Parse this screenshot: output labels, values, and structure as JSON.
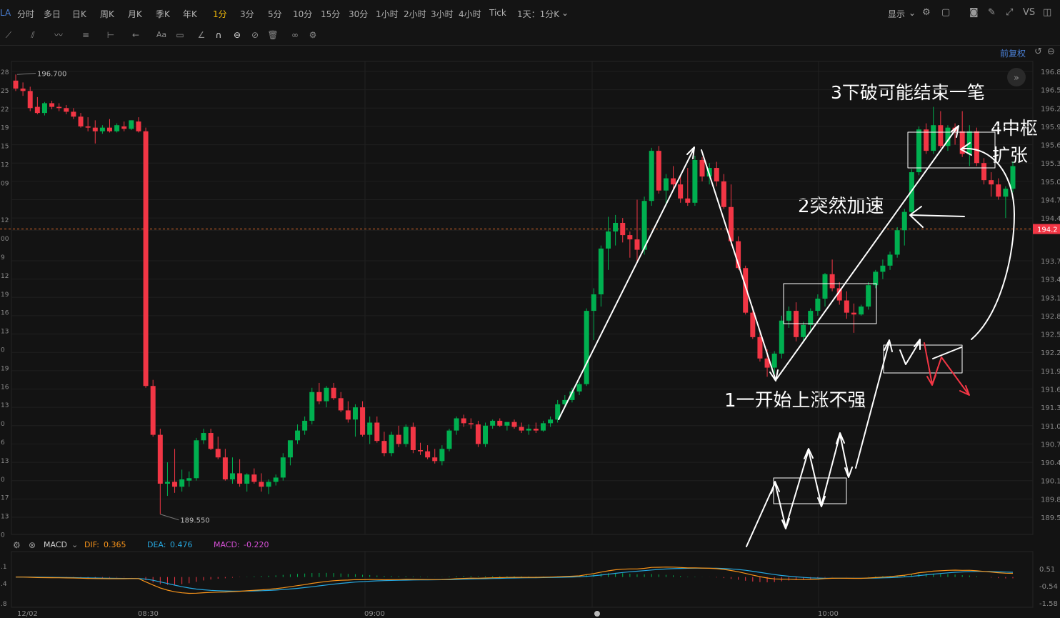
{
  "toolbar": {
    "symbol_short": "LA",
    "tabs": [
      "分时",
      "多日",
      "日K",
      "周K",
      "月K",
      "季K",
      "年K",
      "1分",
      "3分",
      "5分",
      "10分",
      "15分",
      "30分",
      "1小时",
      "2小时",
      "3小时",
      "4小时",
      "Tick"
    ],
    "active_tab": "1分",
    "range_selector": "1天：1分K",
    "display_label": "显示",
    "vs_label": "VS",
    "fuquan_label": "前复权"
  },
  "colors": {
    "up": "#00b050",
    "down": "#f23645",
    "background": "#131313",
    "dif": "#f7931a",
    "dea": "#26a8e0",
    "macd": "#d44fd4",
    "ref_line": "#e06a2a"
  },
  "chart_data": {
    "type": "candlestick",
    "timeframe": "1分",
    "price_axis_ticks": [
      "196.8",
      "196.5",
      "196.2",
      "195.9",
      "195.6",
      "195.3",
      "195.0",
      "194.7",
      "194.4",
      "194.2",
      "193.7",
      "193.4",
      "193.1",
      "192.8",
      "192.5",
      "192.2",
      "191.9",
      "191.6",
      "191.3",
      "191.0",
      "190.7",
      "190.4",
      "190.1",
      "189.8",
      "189.5"
    ],
    "price_axis_ticks_left": [
      "28",
      "25",
      "22",
      "19",
      "15",
      "12",
      "09",
      "",
      "12",
      "00",
      "9",
      "12",
      "19",
      "16",
      "13",
      "0",
      "19",
      "16",
      "13",
      "0",
      "6",
      "13",
      "0",
      "17",
      "13",
      "0"
    ],
    "ylim": [
      189.3,
      196.9
    ],
    "time_labels": [
      "12/02",
      "08:30",
      "09:00",
      "10:00"
    ],
    "current_price_label": "194.2",
    "current_price": 194.22,
    "high_label": "196.700",
    "low_label": "189.550",
    "ohlc": [
      [
        196.65,
        196.75,
        196.48,
        196.52
      ],
      [
        196.52,
        196.62,
        196.4,
        196.48
      ],
      [
        196.48,
        196.55,
        196.15,
        196.2
      ],
      [
        196.22,
        196.38,
        196.1,
        196.12
      ],
      [
        196.12,
        196.3,
        196.08,
        196.28
      ],
      [
        196.28,
        196.32,
        196.18,
        196.22
      ],
      [
        196.22,
        196.28,
        196.15,
        196.2
      ],
      [
        196.2,
        196.25,
        196.1,
        196.14
      ],
      [
        196.14,
        196.2,
        196.02,
        196.06
      ],
      [
        196.06,
        196.12,
        195.88,
        195.9
      ],
      [
        195.9,
        196.05,
        195.82,
        195.88
      ],
      [
        195.88,
        196.0,
        195.62,
        195.82
      ],
      [
        195.82,
        195.92,
        195.78,
        195.88
      ],
      [
        195.88,
        196.02,
        195.8,
        195.82
      ],
      [
        195.82,
        195.95,
        195.8,
        195.92
      ],
      [
        195.9,
        195.98,
        195.82,
        195.86
      ],
      [
        195.86,
        196.0,
        195.84,
        196.0
      ],
      [
        195.98,
        196.05,
        195.8,
        195.82
      ],
      [
        195.82,
        195.88,
        191.62,
        191.65
      ],
      [
        191.65,
        191.75,
        190.82,
        190.85
      ],
      [
        190.85,
        190.95,
        189.55,
        190.05
      ],
      [
        190.05,
        190.4,
        189.85,
        190.08
      ],
      [
        190.08,
        190.62,
        189.9,
        190.0
      ],
      [
        190.0,
        190.28,
        189.92,
        190.12
      ],
      [
        190.1,
        190.25,
        190.0,
        190.14
      ],
      [
        190.14,
        190.8,
        190.1,
        190.76
      ],
      [
        190.76,
        190.95,
        190.7,
        190.88
      ],
      [
        190.88,
        190.95,
        190.6,
        190.62
      ],
      [
        190.62,
        190.82,
        190.45,
        190.48
      ],
      [
        190.48,
        190.62,
        190.1,
        190.12
      ],
      [
        190.12,
        190.48,
        190.05,
        190.22
      ],
      [
        190.22,
        190.45,
        190.0,
        190.05
      ],
      [
        190.05,
        190.22,
        189.92,
        190.2
      ],
      [
        190.2,
        190.3,
        190.05,
        190.08
      ],
      [
        190.08,
        190.22,
        189.92,
        190.0
      ],
      [
        190.0,
        190.12,
        189.88,
        190.08
      ],
      [
        190.08,
        190.2,
        190.02,
        190.15
      ],
      [
        190.15,
        190.55,
        190.1,
        190.48
      ],
      [
        190.48,
        190.72,
        190.35,
        190.76
      ],
      [
        190.76,
        191.02,
        190.7,
        190.92
      ],
      [
        190.92,
        191.15,
        190.85,
        191.08
      ],
      [
        191.08,
        191.62,
        191.02,
        191.55
      ],
      [
        191.55,
        191.7,
        191.35,
        191.4
      ],
      [
        191.4,
        191.65,
        191.3,
        191.62
      ],
      [
        191.62,
        191.7,
        191.42,
        191.45
      ],
      [
        191.45,
        191.55,
        191.22,
        191.25
      ],
      [
        191.25,
        191.4,
        191.05,
        191.1
      ],
      [
        191.1,
        191.35,
        190.82,
        191.3
      ],
      [
        191.3,
        191.4,
        190.82,
        190.85
      ],
      [
        190.85,
        191.15,
        190.7,
        191.05
      ],
      [
        191.05,
        191.15,
        190.72,
        190.75
      ],
      [
        190.75,
        190.9,
        190.5,
        190.55
      ],
      [
        190.55,
        190.9,
        190.5,
        190.85
      ],
      [
        190.85,
        191.0,
        190.65,
        190.7
      ],
      [
        190.7,
        191.02,
        190.65,
        190.98
      ],
      [
        190.98,
        191.05,
        190.55,
        190.6
      ],
      [
        190.6,
        190.72,
        190.52,
        190.58
      ],
      [
        190.58,
        190.68,
        190.45,
        190.48
      ],
      [
        190.48,
        190.62,
        190.38,
        190.42
      ],
      [
        190.42,
        190.68,
        190.35,
        190.62
      ],
      [
        190.62,
        190.95,
        190.58,
        190.92
      ],
      [
        190.92,
        191.15,
        190.85,
        191.12
      ],
      [
        191.12,
        191.18,
        190.98,
        191.04
      ],
      [
        191.04,
        191.12,
        190.95,
        191.02
      ],
      [
        191.02,
        191.08,
        190.65,
        190.7
      ],
      [
        190.7,
        191.05,
        190.65,
        191.0
      ],
      [
        191.0,
        191.1,
        190.95,
        191.08
      ],
      [
        191.08,
        191.12,
        190.98,
        191.0
      ],
      [
        191.0,
        191.05,
        190.92,
        191.06
      ],
      [
        191.06,
        191.1,
        190.95,
        190.98
      ],
      [
        190.98,
        191.05,
        190.88,
        190.92
      ],
      [
        190.92,
        191.02,
        190.85,
        190.95
      ],
      [
        190.95,
        191.05,
        190.88,
        190.92
      ],
      [
        190.92,
        191.08,
        190.9,
        191.04
      ],
      [
        191.04,
        191.15,
        190.98,
        191.1
      ],
      [
        191.1,
        191.42,
        191.05,
        191.35
      ],
      [
        191.35,
        191.5,
        191.3,
        191.42
      ],
      [
        191.42,
        191.62,
        191.38,
        191.56
      ],
      [
        191.56,
        191.72,
        191.5,
        191.68
      ],
      [
        191.68,
        192.92,
        191.65,
        192.88
      ],
      [
        192.88,
        193.25,
        192.4,
        193.15
      ],
      [
        193.15,
        193.95,
        192.95,
        193.9
      ],
      [
        193.9,
        194.42,
        193.55,
        194.18
      ],
      [
        194.18,
        194.45,
        193.95,
        194.32
      ],
      [
        194.32,
        194.4,
        194.0,
        194.12
      ],
      [
        194.12,
        194.18,
        193.75,
        194.05
      ],
      [
        194.05,
        194.7,
        193.7,
        193.88
      ],
      [
        193.88,
        194.75,
        193.8,
        194.68
      ],
      [
        194.68,
        195.55,
        194.6,
        195.5
      ],
      [
        195.5,
        195.58,
        194.8,
        194.85
      ],
      [
        194.85,
        195.12,
        194.6,
        195.05
      ],
      [
        195.05,
        195.25,
        194.85,
        194.95
      ],
      [
        194.95,
        195.1,
        194.65,
        194.72
      ],
      [
        194.72,
        195.22,
        194.6,
        194.65
      ],
      [
        194.65,
        195.42,
        194.6,
        195.35
      ],
      [
        195.35,
        195.4,
        195.0,
        195.08
      ],
      [
        195.08,
        195.3,
        194.95,
        195.22
      ],
      [
        195.22,
        195.32,
        194.92,
        195.0
      ],
      [
        195.0,
        195.12,
        194.55,
        194.58
      ],
      [
        194.58,
        194.95,
        193.95,
        194.02
      ],
      [
        194.02,
        194.1,
        193.55,
        193.58
      ],
      [
        193.58,
        193.62,
        192.82,
        192.85
      ],
      [
        192.85,
        192.95,
        192.42,
        192.45
      ],
      [
        192.45,
        192.55,
        192.05,
        192.1
      ],
      [
        192.1,
        192.25,
        191.8,
        191.95
      ],
      [
        191.95,
        192.22,
        191.85,
        192.18
      ],
      [
        192.18,
        192.8,
        192.1,
        192.72
      ],
      [
        192.72,
        192.95,
        192.6,
        192.88
      ],
      [
        192.88,
        193.02,
        192.38,
        192.45
      ],
      [
        192.45,
        192.7,
        192.38,
        192.65
      ],
      [
        192.65,
        192.92,
        192.55,
        192.88
      ],
      [
        192.88,
        193.15,
        192.8,
        193.08
      ],
      [
        193.08,
        193.5,
        192.95,
        193.48
      ],
      [
        193.48,
        193.72,
        193.2,
        193.25
      ],
      [
        193.25,
        193.35,
        192.98,
        193.05
      ],
      [
        193.05,
        193.2,
        192.75,
        192.85
      ],
      [
        192.85,
        193.0,
        192.52,
        192.82
      ],
      [
        192.82,
        192.98,
        192.8,
        192.95
      ],
      [
        192.95,
        193.35,
        192.9,
        193.3
      ],
      [
        193.3,
        193.55,
        193.25,
        193.52
      ],
      [
        193.52,
        193.72,
        193.4,
        193.62
      ],
      [
        193.62,
        193.85,
        193.55,
        193.8
      ],
      [
        193.8,
        194.25,
        193.75,
        194.2
      ],
      [
        194.2,
        194.55,
        193.95,
        194.5
      ],
      [
        194.5,
        195.2,
        194.45,
        195.15
      ],
      [
        195.15,
        195.9,
        195.1,
        195.85
      ],
      [
        195.85,
        195.95,
        195.45,
        195.5
      ],
      [
        195.5,
        196.22,
        195.45,
        195.92
      ],
      [
        195.92,
        196.15,
        195.55,
        195.58
      ],
      [
        195.58,
        195.92,
        195.5,
        195.88
      ],
      [
        195.88,
        195.95,
        195.6,
        195.82
      ],
      [
        195.82,
        196.15,
        195.4,
        195.45
      ],
      [
        195.45,
        195.92,
        195.25,
        195.82
      ],
      [
        195.82,
        195.88,
        195.25,
        195.3
      ],
      [
        195.3,
        195.38,
        194.95,
        195.02
      ],
      [
        195.02,
        195.15,
        194.75,
        194.95
      ],
      [
        194.95,
        195.05,
        194.7,
        194.75
      ],
      [
        194.75,
        194.92,
        194.4,
        194.88
      ],
      [
        194.88,
        195.32,
        194.82,
        195.25
      ]
    ],
    "macd": {
      "label": "MACD",
      "dif_label": "DIF:",
      "dif_value": "0.365",
      "dea_label": "DEA:",
      "dea_value": "0.476",
      "macd_label": "MACD:",
      "macd_value": "-0.220",
      "axis_ticks": [
        "0.51",
        "-0.54",
        "-1.58"
      ],
      "axis_ticks_left": [
        ".1",
        ".4",
        ".8"
      ]
    }
  },
  "annotations": {
    "note1": "1一开始上涨不强",
    "note2": "2突然加速",
    "note3": "3下破可能结束一笔",
    "note4_line1": "4中枢",
    "note4_line2": "扩张"
  }
}
